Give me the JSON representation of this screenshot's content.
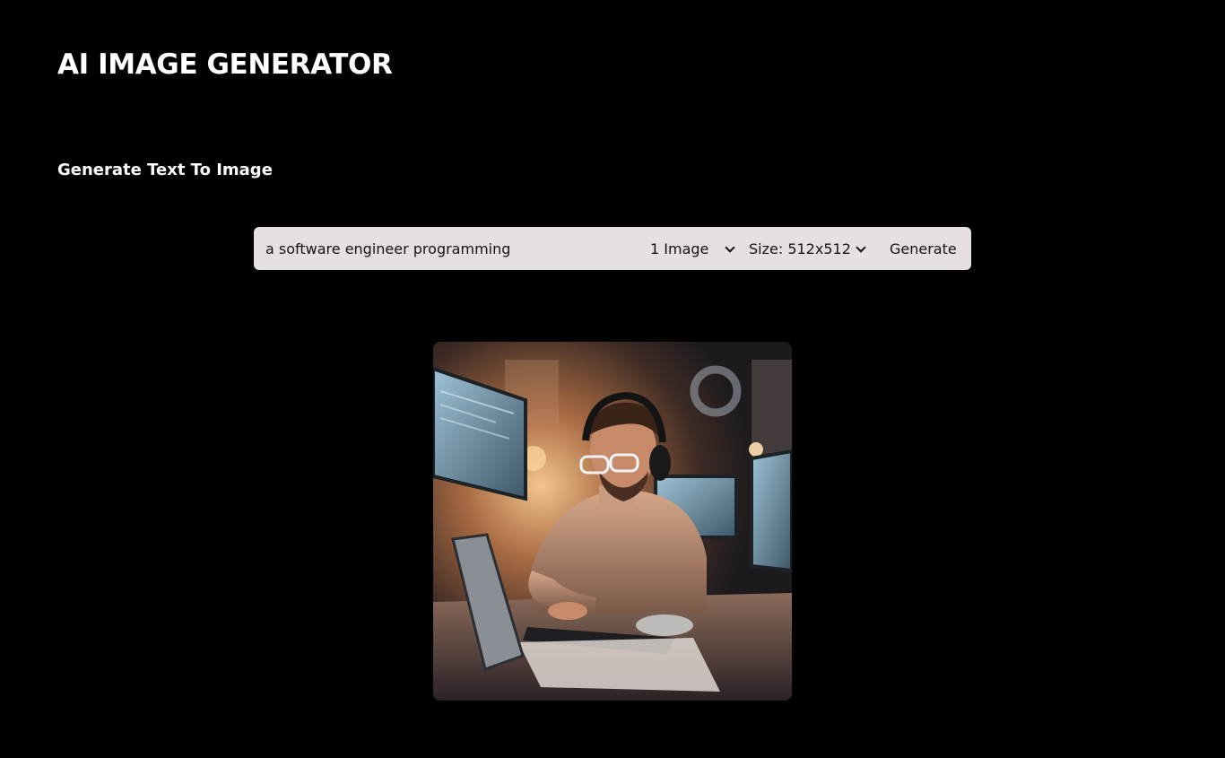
{
  "header": {
    "title": "AI IMAGE GENERATOR"
  },
  "section": {
    "title": "Generate Text To Image"
  },
  "form": {
    "prompt_value": "a software engineer programming",
    "image_count": "1 Image",
    "image_size": "Size: 512x512",
    "generate_label": "Generate"
  },
  "result": {
    "image_description_icon": "generated-image"
  },
  "colors": {
    "background": "#000000",
    "form_bar": "#e6e0e0",
    "text_light": "#ffffff",
    "text_dark": "#141414"
  }
}
